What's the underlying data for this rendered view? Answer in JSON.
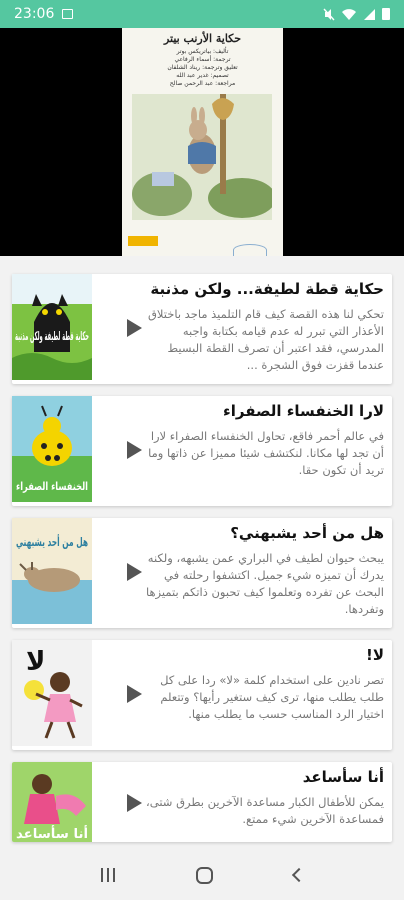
{
  "status_bar": {
    "time": "23:06",
    "icons": [
      "photo-icon",
      "mute-icon",
      "wifi-icon",
      "signal-icon",
      "battery-icon"
    ]
  },
  "video": {
    "cover_title": "حكاية الأرنب بيتر",
    "cover_lines": [
      "تأليف: بياتريكس بوتر",
      "ترجمة: أسماء الرفاعي",
      "تعليق وترجمة: ريناد الشلفان",
      "تصميم: غدير عبد الله",
      "مراجعة: عبد الرحمن صالح"
    ]
  },
  "stories": [
    {
      "title": "حكاية قطة لطيفة... ولكن مذنبة",
      "description": "تحكي لنا هذه القصة كيف قام التلميذ ماجد باختلاق الأعذار التي تبرر له عدم قيامه بكتابة واجبه المدرسي، فقد اعتبر أن تصرف القطة البسيط عندما قفزت فوق الشجرة ...",
      "thumb_text": "حكاية قطة لطيفة ولكن مذنبة"
    },
    {
      "title": "لارا الخنفساء الصفراء",
      "description": "في عالم أحمر فاقع، تحاول الخنفساء الصفراء لارا أن تجد لها مكانا. لنكتشف شيئا مميزا عن ذاتها وما تريد أن تكون حقا.",
      "thumb_text": "الخنفساء الصفراء"
    },
    {
      "title": "هل من أحد يشبهني؟",
      "description": "يبحث حيوان لطيف في البراري عمن يشبهه، ولكنه يدرك أن تميزه شيء جميل. اكتشفوا رحلته في البحث عن تفرده وتعلموا كيف تحبون ذاتكم بتميزها وتفردها.",
      "thumb_text": "هل من أحد يشبهني"
    },
    {
      "title": "لا!",
      "description": "تصر نادين على استخدام كلمة «لا» ردا على كل طلب يطلب منها، ترى كيف ستغير رأيها؟ وتتعلم اختيار الرد المناسب حسب ما يطلب منها.",
      "thumb_text": "لا"
    },
    {
      "title": "أنا سأساعد",
      "description": "يمكن للأطفال الكبار مساعدة الآخرين بطرق شتى، فمساعدة الآخرين شيء ممتع.",
      "thumb_text": "أنا سأساعد"
    }
  ],
  "colors": {
    "status_bar": "#55c7a0",
    "play_icon": "#555555"
  }
}
